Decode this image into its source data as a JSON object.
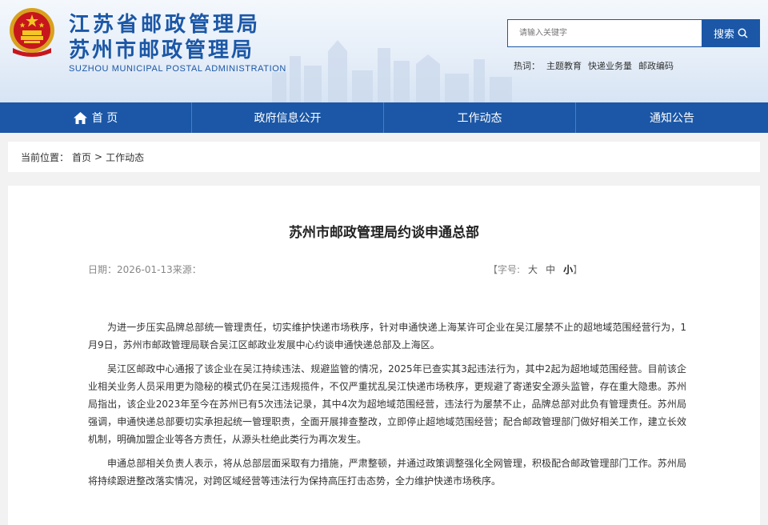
{
  "header": {
    "title_line1": "江苏省邮政管理局",
    "title_line2": "苏州市邮政管理局",
    "title_en": "SUZHOU MUNICIPAL POSTAL ADMINISTRATION",
    "search_placeholder": "请输入关键字",
    "search_button": "搜索",
    "hot_label": "热词：",
    "hot_words": [
      "主题教育",
      "快递业务量",
      "邮政编码"
    ]
  },
  "nav": {
    "items": [
      "首 页",
      "政府信息公开",
      "工作动态",
      "通知公告"
    ]
  },
  "breadcrumb": {
    "label": "当前位置：",
    "home": "首页",
    "separator": ">",
    "current": "工作动态"
  },
  "article": {
    "title": "苏州市邮政管理局约谈申通总部",
    "meta": "日期：2026-01-13来源：",
    "font_size": {
      "open": "【字号:",
      "large": "大",
      "medium": "中",
      "small": "小",
      "close": "】"
    },
    "paragraphs": [
      "为进一步压实品牌总部统一管理责任，切实维护快递市场秩序，针对申通快递上海某许可企业在吴江屡禁不止的超地域范围经营行为，1月9日，苏州市邮政管理局联合吴江区邮政业发展中心约谈申通快递总部及上海区。",
      "吴江区邮政中心通报了该企业在吴江持续违法、规避监管的情况，2025年已查实其3起违法行为，其中2起为超地域范围经营。目前该企业相关业务人员采用更为隐秘的模式仍在吴江违规揽件，不仅严重扰乱吴江快递市场秩序，更规避了寄递安全源头监管，存在重大隐患。苏州局指出，该企业2023年至今在苏州已有5次违法记录，其中4次为超地域范围经营，违法行为屡禁不止，品牌总部对此负有管理责任。苏州局强调，申通快递总部要切实承担起统一管理职责，全面开展排查整改，立即停止超地域范围经营；配合邮政管理部门做好相关工作，建立长效机制，明确加盟企业等各方责任，从源头杜绝此类行为再次发生。",
      "申通总部相关负责人表示，将从总部层面采取有力措施，严肃整顿，并通过政策调整强化全网管理，积极配合邮政管理部门工作。苏州局将持续跟进整改落实情况，对跨区域经营等违法行为保持高压打击态势，全力维护快递市场秩序。"
    ]
  },
  "colors": {
    "brand_blue": "#1b57a6",
    "nav_bg": "#1b57a6",
    "page_bg": "#f2f2f2"
  }
}
